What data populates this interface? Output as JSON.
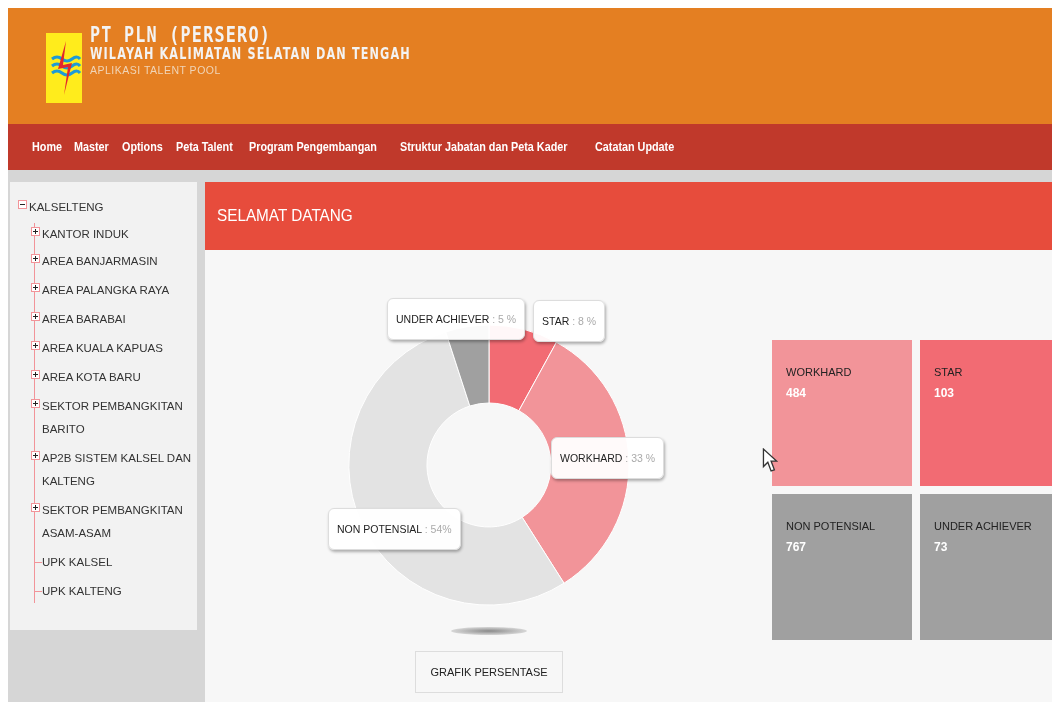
{
  "header": {
    "title": "PT PLN (PERSERO)",
    "subtitle": "WILAYAH KALIMATAN SELATAN DAN TENGAH",
    "app_name": "APLIKASI TALENT POOL"
  },
  "nav": [
    "Home",
    "Master",
    "Options",
    "Peta Talent",
    "Program Pengembangan",
    "Struktur Jabatan dan Peta Kader",
    "Catatan Update"
  ],
  "tree": [
    {
      "label": "KALSELTENG",
      "expanded": true,
      "children": [
        {
          "label": "KANTOR INDUK",
          "expanded": false
        },
        {
          "label": "AREA BANJARMASIN",
          "expanded": false
        },
        {
          "label": "AREA PALANGKA RAYA",
          "expanded": false
        },
        {
          "label": "AREA BARABAI",
          "expanded": false
        },
        {
          "label": "AREA KUALA KAPUAS",
          "expanded": false
        },
        {
          "label": "AREA KOTA BARU",
          "expanded": false
        },
        {
          "label": "SEKTOR PEMBANGKITAN BARITO",
          "expanded": false
        },
        {
          "label": "AP2B SISTEM KALSEL DAN KALTENG",
          "expanded": false
        },
        {
          "label": "SEKTOR PEMBANGKITAN ASAM-ASAM",
          "expanded": false
        },
        {
          "label": "UPK KALSEL"
        },
        {
          "label": "UPK KALTENG"
        }
      ]
    }
  ],
  "panel": {
    "title": "SELAMAT DATANG",
    "chart_data": {
      "type": "donut",
      "categories": [
        "STAR",
        "WORKHARD",
        "NON POTENSIAL",
        "UNDER ACHIEVER"
      ],
      "values": [
        8,
        33,
        54,
        5
      ],
      "colors": [
        "#f26b73",
        "#f29499",
        "#e3e3e3",
        "#a0a0a0"
      ],
      "value_labels": [
        ": 8 %",
        ": 33 %",
        ": 54%",
        ": 5 %"
      ]
    },
    "chart_button": "GRAFIK PERSENTASE",
    "tiles": [
      {
        "label": "WORKHARD",
        "count": "484",
        "color": "#f29499"
      },
      {
        "label": "STAR",
        "count": "103",
        "color": "#f26b73"
      },
      {
        "label": "NON POTENSIAL",
        "count": "767",
        "color": "#a0a0a0"
      },
      {
        "label": "UNDER ACHIEVER",
        "count": "73",
        "color": "#a0a0a0"
      }
    ]
  }
}
